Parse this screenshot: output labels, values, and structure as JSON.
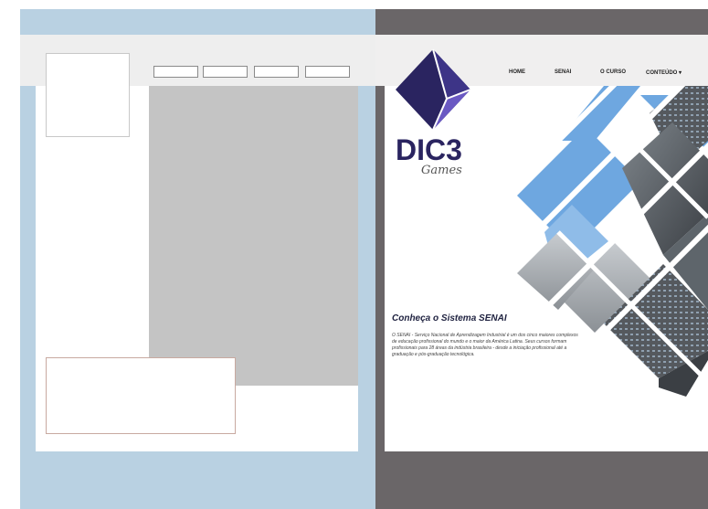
{
  "left_wireframe": {
    "nav_placeholders": 4
  },
  "right_mockup": {
    "logo": {
      "name": "DIC3",
      "tagline": "Games",
      "colors": {
        "primary": "#2a2460",
        "accent": "#6a59c3"
      }
    },
    "nav": {
      "items": [
        "HOME",
        "SENAI",
        "O CURSO",
        "CONTEÚDO ▾"
      ]
    },
    "headline": "Conheça o Sistema SENAI",
    "paragraph": "O SENAI - Serviço Nacional de Aprendizagem Industrial é um dos cinco maiores complexos de educação profissional do mundo e o maior da América Latina. Seus cursos formam profissionais para 28 áreas da indústria brasileira - desde a iniciação profissional até a graduação e pós-graduação tecnológica."
  },
  "colors": {
    "left_bg": "#b9d1e2",
    "right_bg": "#6a6668",
    "hero_sky": "#6ea7e0"
  }
}
